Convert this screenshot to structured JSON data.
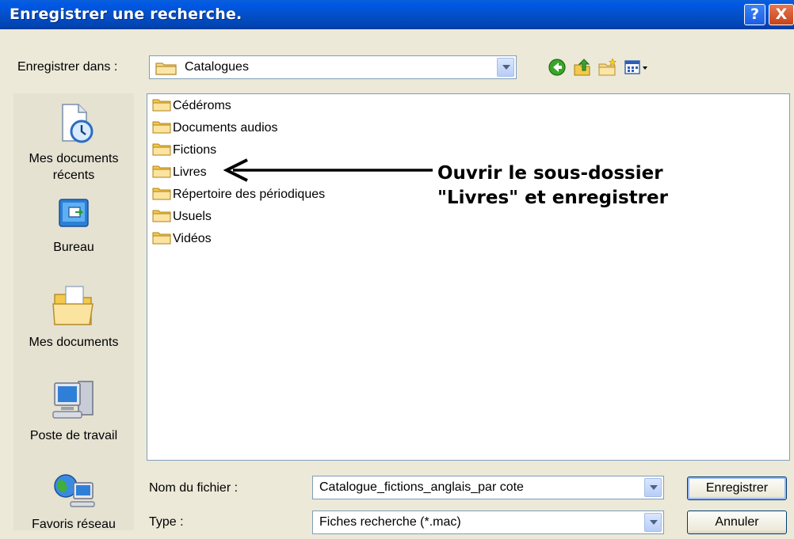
{
  "window": {
    "title": "Enregistrer une recherche."
  },
  "titlebar": {
    "help_glyph": "?",
    "close_glyph": "X"
  },
  "save_in": {
    "label": "Enregistrer dans :",
    "value": "Catalogues"
  },
  "toolbar": {
    "icons": [
      "back-icon",
      "up-folder-icon",
      "new-folder-icon",
      "view-menu-icon"
    ]
  },
  "places": [
    {
      "label": "Mes documents récents",
      "icon": "recent-documents-icon"
    },
    {
      "label": "Bureau",
      "icon": "desktop-icon"
    },
    {
      "label": "Mes documents",
      "icon": "my-documents-icon"
    },
    {
      "label": "Poste de travail",
      "icon": "my-computer-icon"
    },
    {
      "label": "Favoris réseau",
      "icon": "network-places-icon"
    }
  ],
  "files": [
    {
      "name": "Cédéroms"
    },
    {
      "name": "Documents audios"
    },
    {
      "name": "Fictions"
    },
    {
      "name": "Livres"
    },
    {
      "name": "Répertoire des périodiques"
    },
    {
      "name": "Usuels"
    },
    {
      "name": "Vidéos"
    }
  ],
  "annotation": {
    "line1": "Ouvrir le sous-dossier",
    "line2": "\"Livres\" et enregistrer"
  },
  "filename": {
    "label": "Nom du fichier :",
    "value": "Catalogue_fictions_anglais_par cote"
  },
  "filetype": {
    "label": "Type :",
    "value": "Fiches recherche (*.mac)"
  },
  "buttons": {
    "save": "Enregistrer",
    "cancel": "Annuler"
  },
  "colors": {
    "titlebar": "#0350c8",
    "dialog_bg": "#ece9d8",
    "folder": "#f2d37a",
    "annotation": "#000000"
  }
}
